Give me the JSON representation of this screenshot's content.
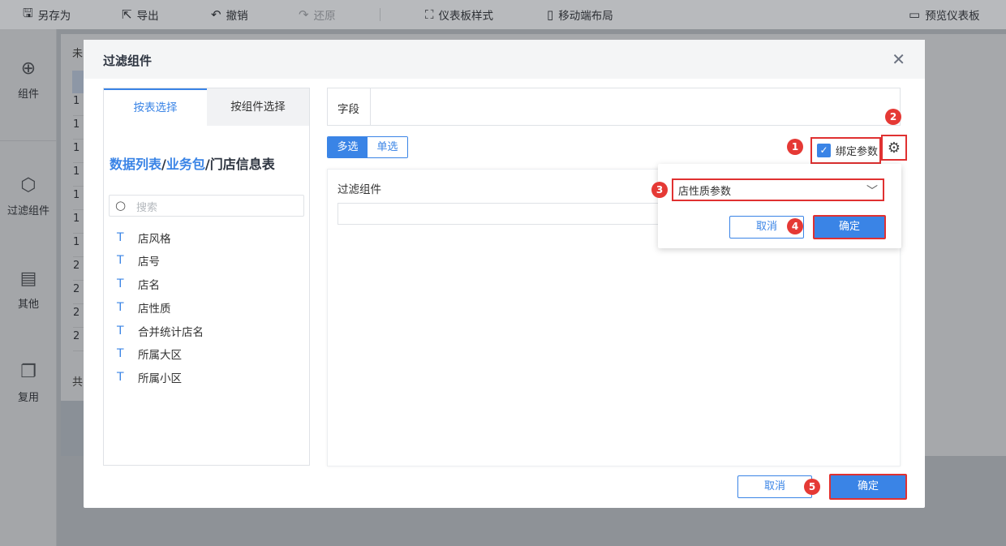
{
  "toolbar": {
    "save_as": "另存为",
    "export": "导出",
    "undo": "撤销",
    "redo": "还原",
    "dashboard_style": "仪表板样式",
    "mobile_layout": "移动端布局",
    "preview": "预览仪表板"
  },
  "leftbar": {
    "component": "组件",
    "filter_component": "过滤组件",
    "other": "其他",
    "reuse": "复用"
  },
  "background": {
    "header_char": "未",
    "row_chars": [
      "1",
      "1",
      "1",
      "1",
      "1",
      "1",
      "1",
      "2",
      "2",
      "2",
      "2"
    ],
    "footer_char": "共"
  },
  "modal": {
    "title": "过滤组件",
    "tabs": {
      "by_table": "按表选择",
      "by_component": "按组件选择"
    },
    "breadcrumb": {
      "part1": "数据列表",
      "sep1": "/",
      "part2": "业务包",
      "sep2": "/",
      "part3": "门店信息表"
    },
    "search_placeholder": "搜索",
    "field_type_icon": "T",
    "fields": [
      "店风格",
      "店号",
      "店名",
      "店性质",
      "合并统计店名",
      "所属大区",
      "所属小区"
    ],
    "field_label": "字段",
    "mode_multi": "多选",
    "mode_single": "单选",
    "bind_param_label": "绑定参数",
    "filter_label": "过滤组件",
    "param_select": "店性质参数",
    "popup_cancel": "取消",
    "popup_ok": "确定",
    "cancel": "取消",
    "ok": "确定"
  },
  "badges": [
    "1",
    "2",
    "3",
    "4",
    "5"
  ],
  "colors": {
    "accent": "#3a84e6",
    "highlight": "#e03131",
    "badge": "#e53935"
  }
}
